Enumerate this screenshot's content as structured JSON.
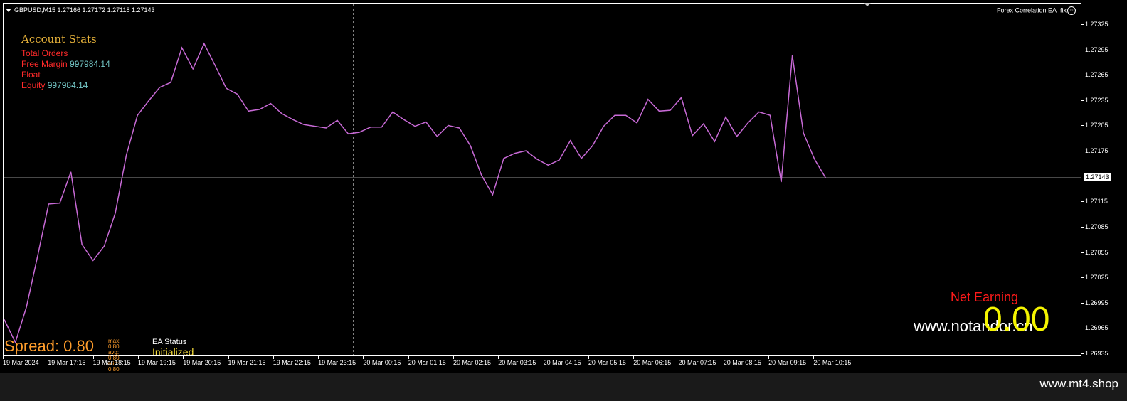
{
  "header": {
    "symbol_line": "GBPUSD,M15  1.27166 1.27172 1.27118 1.27143",
    "ea_name": "Forex Correlation EA_fix"
  },
  "icons": {
    "menu": "triangle-down-icon",
    "ea": "smiley-icon"
  },
  "account_stats": {
    "title": "Account Stats",
    "total_orders_label": "Total Orders",
    "free_margin_label": "Free Margin",
    "free_margin_value": "997984.14",
    "float_label": "Float",
    "equity_label": "Equity",
    "equity_value": "997984.14"
  },
  "spread": {
    "label": "Spread: 0.80",
    "max_label": "max:",
    "max_value": "0.80",
    "avg_label": "avg:",
    "avg_value": "0.80",
    "min_label": "min:",
    "min_value": "0.80"
  },
  "ea_status": {
    "label": "EA Status",
    "value": "Initialized"
  },
  "net_earning": {
    "label": "Net Earning",
    "value": "0.00"
  },
  "watermarks": {
    "inner": "www.notandor.cn",
    "footer": "www.mt4.shop"
  },
  "colors": {
    "line": "#c86ad6",
    "price_line": "#c0c0c0",
    "stats_label": "#ff2a2a",
    "stats_value": "#74c7c7"
  },
  "chart_data": {
    "type": "line",
    "y_ticks": [
      "1.27325",
      "1.27295",
      "1.27265",
      "1.27235",
      "1.27205",
      "1.27175",
      "1.27143",
      "1.27115",
      "1.27085",
      "1.27055",
      "1.27025",
      "1.26995",
      "1.26965",
      "1.26935"
    ],
    "current_price": "1.27143",
    "ylim": [
      1.2692,
      1.2734
    ],
    "x_ticks": [
      "19 Mar 2024",
      "19 Mar 17:15",
      "19 Mar 18:15",
      "19 Mar 19:15",
      "19 Mar 20:15",
      "19 Mar 21:15",
      "19 Mar 22:15",
      "19 Mar 23:15",
      "20 Mar 00:15",
      "20 Mar 01:15",
      "20 Mar 02:15",
      "20 Mar 03:15",
      "20 Mar 04:15",
      "20 Mar 05:15",
      "20 Mar 06:15",
      "20 Mar 07:15",
      "20 Mar 08:15",
      "20 Mar 09:15",
      "20 Mar 10:15"
    ],
    "values": [
      1.26975,
      1.26948,
      1.2699,
      1.2705,
      1.27112,
      1.27113,
      1.2715,
      1.27064,
      1.27045,
      1.27062,
      1.27101,
      1.2717,
      1.27217,
      1.27234,
      1.2725,
      1.27256,
      1.27297,
      1.27272,
      1.27302,
      1.27276,
      1.27249,
      1.27242,
      1.27222,
      1.27224,
      1.27231,
      1.27219,
      1.27212,
      1.27206,
      1.27204,
      1.27202,
      1.27211,
      1.27195,
      1.27197,
      1.27203,
      1.27203,
      1.27221,
      1.27212,
      1.27204,
      1.27209,
      1.27192,
      1.27205,
      1.27202,
      1.27181,
      1.27146,
      1.27123,
      1.27166,
      1.27172,
      1.27175,
      1.27165,
      1.27158,
      1.27164,
      1.27187,
      1.27166,
      1.27181,
      1.27204,
      1.27217,
      1.27217,
      1.27208,
      1.27236,
      1.27222,
      1.27223,
      1.27238,
      1.27193,
      1.27207,
      1.27186,
      1.27215,
      1.27192,
      1.27208,
      1.27221,
      1.27217,
      1.27138,
      1.27288,
      1.27196,
      1.27165,
      1.27143
    ]
  }
}
